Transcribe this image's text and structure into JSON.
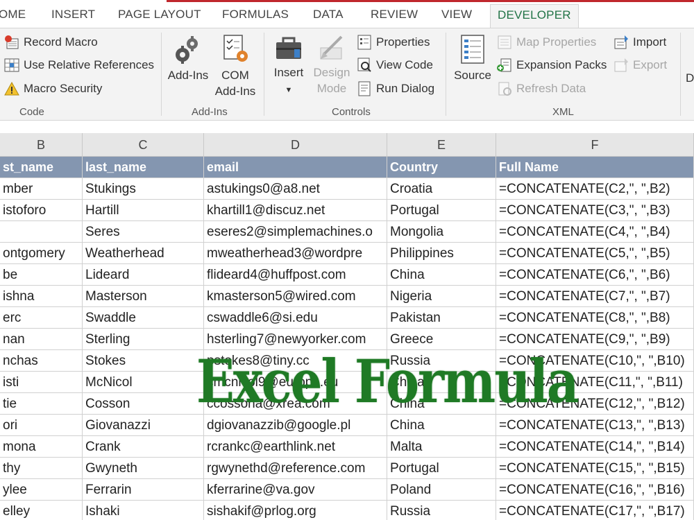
{
  "ribbon_tabs": [
    "OME",
    "INSERT",
    "PAGE LAYOUT",
    "FORMULAS",
    "DATA",
    "REVIEW",
    "VIEW",
    "DEVELOPER"
  ],
  "active_tab": "DEVELOPER",
  "groups": {
    "code": {
      "label": "Code",
      "record_macro": "Record Macro",
      "relative_refs": "Use Relative References",
      "macro_security": "Macro Security"
    },
    "addins": {
      "label": "Add-Ins",
      "addins": "Add-Ins",
      "com_line1": "COM",
      "com_line2": "Add-Ins"
    },
    "controls": {
      "label": "Controls",
      "insert": "Insert",
      "design_line1": "Design",
      "design_line2": "Mode",
      "properties": "Properties",
      "view_code": "View Code",
      "run_dialog": "Run Dialog"
    },
    "xml": {
      "label": "XML",
      "source": "Source",
      "map_properties": "Map Properties",
      "expansion_packs": "Expansion Packs",
      "refresh_data": "Refresh Data",
      "import": "Import",
      "export": "Export",
      "cut_letter": "D"
    }
  },
  "columns": [
    "B",
    "C",
    "D",
    "E",
    "F"
  ],
  "header_row": [
    "st_name",
    "last_name",
    "email",
    "Country",
    "Full Name"
  ],
  "rows": [
    [
      "mber",
      "Stukings",
      "astukings0@a8.net",
      "Croatia",
      "=CONCATENATE(C2,\", \",B2)"
    ],
    [
      "istoforo",
      "Hartill",
      "khartill1@discuz.net",
      "Portugal",
      "=CONCATENATE(C3,\", \",B3)"
    ],
    [
      "",
      "Seres",
      "eseres2@simplemachines.o",
      "Mongolia",
      "=CONCATENATE(C4,\", \",B4)"
    ],
    [
      "ontgomery",
      "Weatherhead",
      "mweatherhead3@wordpre",
      "Philippines",
      "=CONCATENATE(C5,\", \",B5)"
    ],
    [
      "be",
      "Lideard",
      "flideard4@huffpost.com",
      "China",
      "=CONCATENATE(C6,\", \",B6)"
    ],
    [
      "ishna",
      "Masterson",
      "kmasterson5@wired.com",
      "Nigeria",
      "=CONCATENATE(C7,\", \",B7)"
    ],
    [
      "erc",
      "Swaddle",
      "cswaddle6@si.edu",
      "Pakistan",
      "=CONCATENATE(C8,\", \",B8)"
    ],
    [
      "nan",
      "Sterling",
      "hsterling7@newyorker.com",
      "Greece",
      "=CONCATENATE(C9,\", \",B9)"
    ],
    [
      "nchas",
      "Stokes",
      "pstokes8@tiny.cc",
      "Russia",
      "=CONCATENATE(C10,\", \",B10)"
    ],
    [
      "isti",
      "McNicol",
      "cmcnicol9@europa.eu",
      "China",
      "=CONCATENATE(C11,\", \",B11)"
    ],
    [
      "tie",
      "Cosson",
      "ccossona@xrea.com",
      "China",
      "=CONCATENATE(C12,\", \",B12)"
    ],
    [
      "ori",
      "Giovanazzi",
      "dgiovanazzib@google.pl",
      "China",
      "=CONCATENATE(C13,\", \",B13)"
    ],
    [
      "mona",
      "Crank",
      "rcrankc@earthlink.net",
      "Malta",
      "=CONCATENATE(C14,\", \",B14)"
    ],
    [
      "thy",
      "Gwyneth",
      "rgwynethd@reference.com",
      "Portugal",
      "=CONCATENATE(C15,\", \",B15)"
    ],
    [
      "ylee",
      "Ferrarin",
      "kferrarine@va.gov",
      "Poland",
      "=CONCATENATE(C16,\", \",B16)"
    ],
    [
      "elley",
      "Ishaki",
      "sishakif@prlog.org",
      "Russia",
      "=CONCATENATE(C17,\", \",B17)"
    ]
  ],
  "overlay_title": "Excel Formula",
  "colors": {
    "accent_red": "#c0272d",
    "developer_tab": "#217346",
    "header_fill": "#8496b0",
    "overlay_green": "#1f7a25"
  }
}
